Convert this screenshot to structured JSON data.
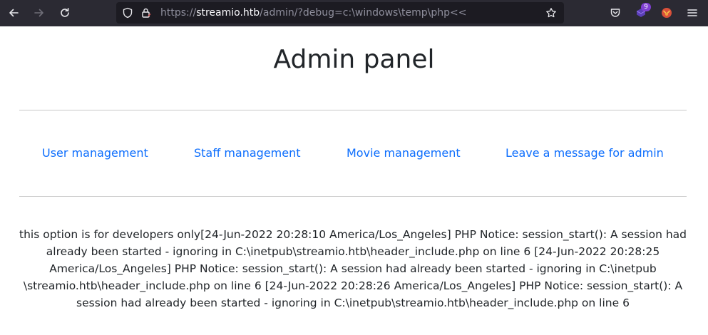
{
  "browser": {
    "url": {
      "scheme": "https://",
      "host": "streamio.htb",
      "path": "/admin/?debug=c:\\windows\\temp\\php<<"
    },
    "extension_badge_count": "9",
    "icons": {
      "back": "arrow-left-icon",
      "forward": "arrow-right-icon",
      "reload": "reload-icon",
      "tracking_protection": "shield-icon",
      "site_security": "lock-icon",
      "bookmark": "star-icon",
      "pocket": "pocket-icon",
      "extension": "extension-icon",
      "foxyproxy": "fox-icon",
      "menu": "hamburger-menu-icon"
    },
    "colors": {
      "toolbar_bg": "#2b2a33",
      "urlbar_bg": "#1c1b22",
      "link": "#0d6efd",
      "badge": "#7f3fd1"
    }
  },
  "page": {
    "title": "Admin panel",
    "nav": [
      {
        "label": "User management"
      },
      {
        "label": "Staff management"
      },
      {
        "label": "Movie management"
      },
      {
        "label": "Leave a message for admin"
      }
    ],
    "debug_output": "this option is for developers only[24-Jun-2022 20:28:10 America/Los_Angeles] PHP Notice: session_start(): A session had already been started - ignoring in C:\\inetpub\\streamio.htb\\header_include.php on line 6 [24-Jun-2022 20:28:25 America/Los_Angeles] PHP Notice: session_start(): A session had already been started - ignoring in C:\\inetpub \\streamio.htb\\header_include.php on line 6 [24-Jun-2022 20:28:26 America/Los_Angeles] PHP Notice: session_start(): A session had already been started - ignoring in C:\\inetpub\\streamio.htb\\header_include.php on line 6"
  }
}
